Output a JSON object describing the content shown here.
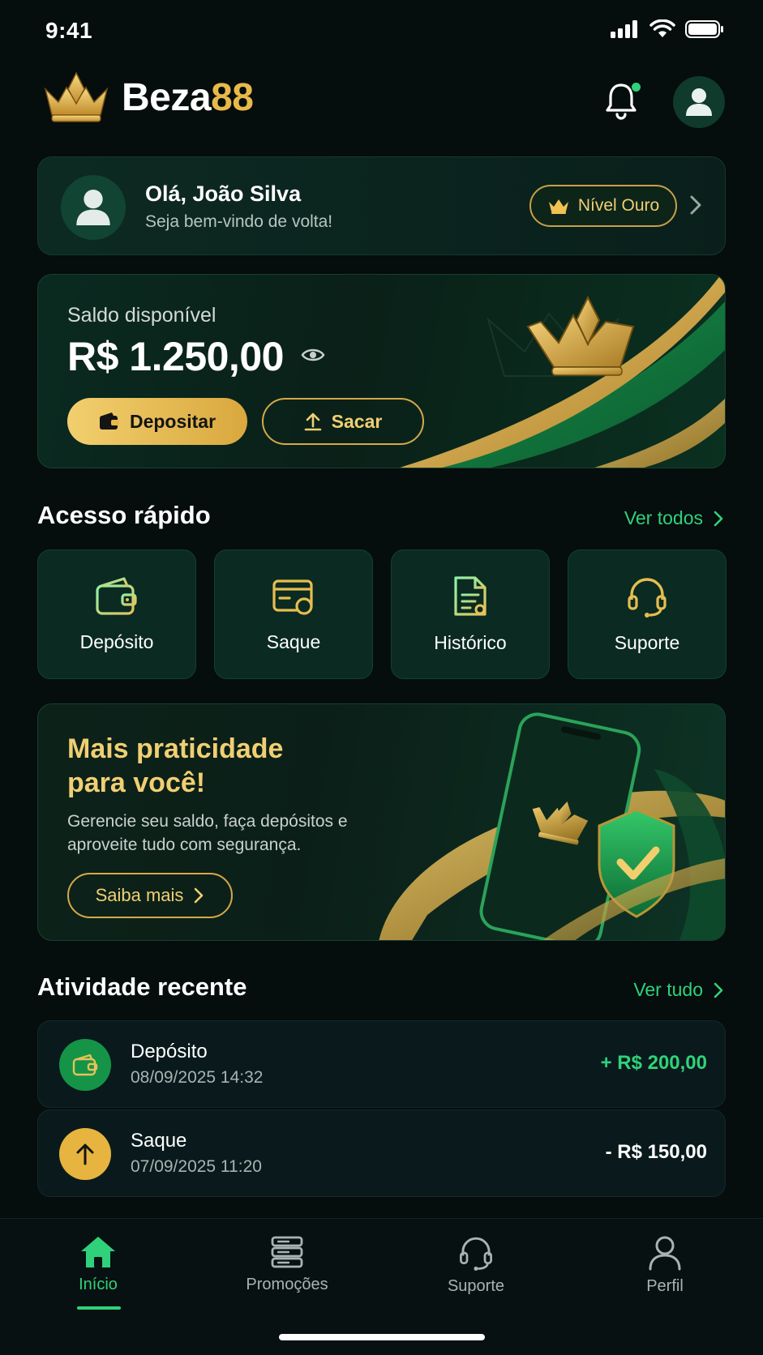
{
  "status_bar": {
    "time": "9:41"
  },
  "brand": {
    "name_main": "Beza",
    "name_accent": "88"
  },
  "user_card": {
    "greeting": "Olá, João Silva",
    "subtitle": "Seja bem-vindo de volta!",
    "level": "Nível Ouro"
  },
  "balance": {
    "label": "Saldo disponível",
    "amount": "R$ 1.250,00",
    "deposit_label": "Depositar",
    "withdraw_label": "Sacar"
  },
  "quick_access": {
    "title": "Acesso rápido",
    "link": "Ver todos",
    "tiles": [
      {
        "label": "Depósito",
        "icon": "wallet-icon"
      },
      {
        "label": "Saque",
        "icon": "card-withdraw-icon"
      },
      {
        "label": "Histórico",
        "icon": "document-icon"
      },
      {
        "label": "Suporte",
        "icon": "headset-icon"
      }
    ]
  },
  "promo": {
    "title": "Mais praticidade para você!",
    "text": "Gerencie seu saldo, faça depósitos e aproveite tudo com segurança.",
    "button": "Saiba mais"
  },
  "activity": {
    "title": "Atividade recente",
    "link": "Ver tudo",
    "items": [
      {
        "title": "Depósito",
        "date": "08/09/2025 14:32",
        "amount": "+ R$ 200,00",
        "color": "#2fd27a"
      },
      {
        "title": "Saque",
        "date": "07/09/2025 11:20",
        "amount": "- R$ 150,00",
        "color": "#ffffff"
      }
    ]
  },
  "bottom_nav": {
    "items": [
      {
        "label": "Início",
        "icon": "home-icon",
        "active": true
      },
      {
        "label": "Promoções",
        "icon": "promotions-icon",
        "active": false
      },
      {
        "label": "Suporte",
        "icon": "headset-icon",
        "active": false
      },
      {
        "label": "Perfil",
        "icon": "user-icon",
        "active": false
      }
    ]
  },
  "colors": {
    "accent_green": "#2fd27a",
    "accent_gold": "#e8b94a",
    "background": "#050d0d"
  }
}
